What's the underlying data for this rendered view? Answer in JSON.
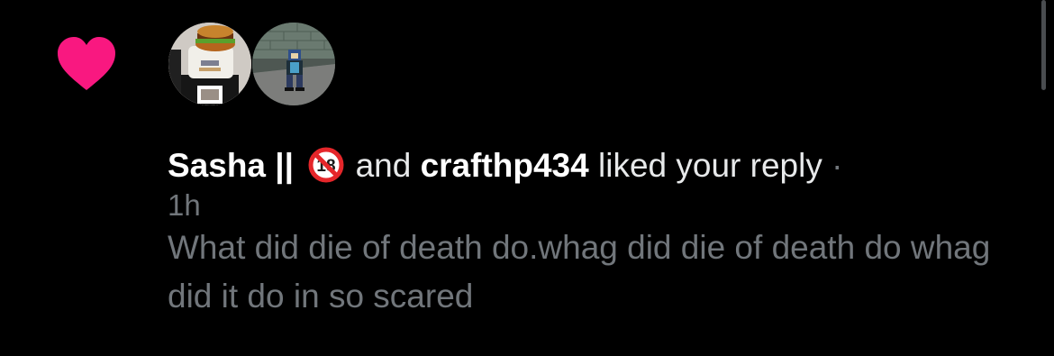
{
  "notification": {
    "type_icon": "heart-icon",
    "accent_color": "#f91880",
    "users": [
      {
        "name": "Sasha ||",
        "badge_icon": "no-under-18-icon"
      },
      {
        "name": "crafthp434"
      }
    ],
    "conjunction": "and",
    "action": "liked your reply",
    "separator": "·",
    "time": "1h",
    "reply_text": "What did die of death do.whag did die of death do whag did it do in so scared"
  }
}
